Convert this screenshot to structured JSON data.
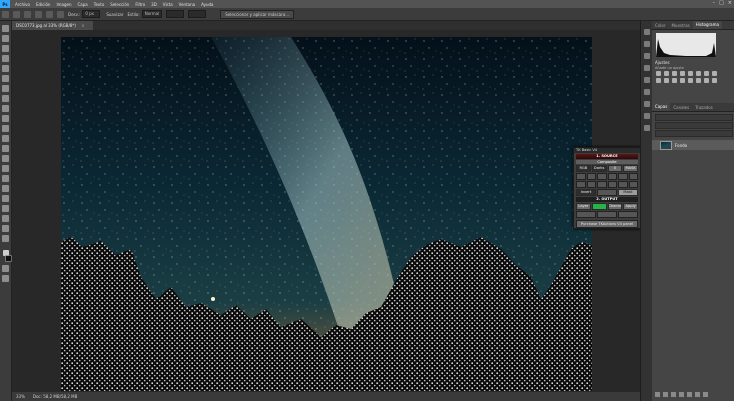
{
  "menubar": {
    "logo": "Ps",
    "items": [
      "Archivo",
      "Edición",
      "Imagen",
      "Capa",
      "Texto",
      "Selección",
      "Filtro",
      "3D",
      "Vista",
      "Ventana",
      "Ayuda"
    ]
  },
  "optionsbar": {
    "desvan_label": "Desv.:",
    "desvan_value": "0 px",
    "suavizar_label": "Suavizar",
    "estilo_label": "Estilo:",
    "estilo_value": "Normal",
    "select_mask_button": "Seleccionar y aplicar máscara..."
  },
  "document": {
    "tab_title": "DSC0773.jpg al 33% (RGB/8*)",
    "zoom": "33%",
    "doc_info": "Doc: 58,2 MB/58,2 MB"
  },
  "panels": {
    "top_tabs": [
      "Color",
      "Muestras",
      "Histograma"
    ],
    "active_top_tab": "Histograma",
    "adjust_title": "Ajustes",
    "adjust_sub": "Añadir un ajuste",
    "layer_tabs": [
      "Capas",
      "Canales",
      "Trazados"
    ],
    "active_layer_tab": "Capas",
    "layer_name": "Fondo"
  },
  "plugin": {
    "title": "TK Basic V4",
    "source_header": "1. SOURCE",
    "source_sub": "Composite",
    "row1": [
      "RGB",
      "Darks",
      "0",
      "MASK"
    ],
    "row2_labels": [
      "Invert",
      "Mask"
    ],
    "output_header": "2. OUTPUT",
    "row3": [
      "Layer",
      "Channel",
      "Apply"
    ],
    "footer": "Purchase TKActions V4 panel"
  },
  "colors": {
    "accent": "#31a8ff",
    "plugin_green": "#25b34a"
  }
}
